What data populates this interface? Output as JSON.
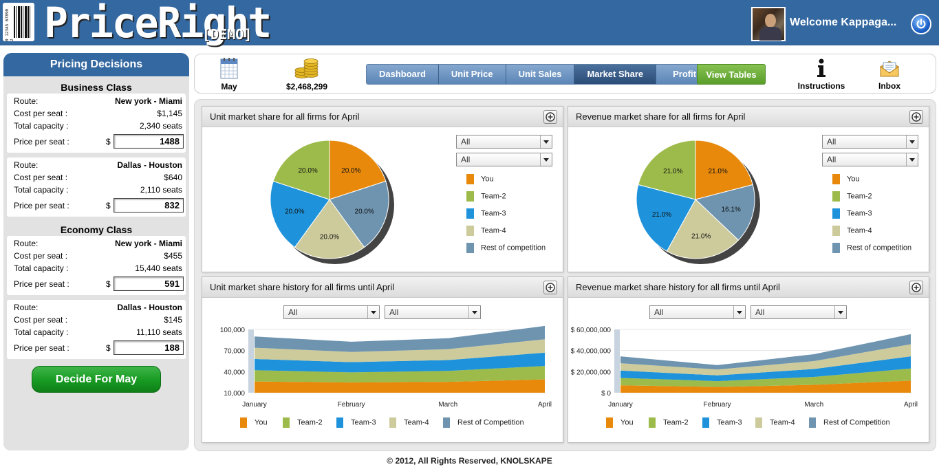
{
  "app": {
    "name": "PriceRight",
    "demo_tag": "[DEMO]",
    "barcode_digits": "0 12345 67890 2",
    "welcome": "Welcome Kappaga...",
    "footer": "© 2012, All Rights Reserved, KNOLSKAPE"
  },
  "pricing": {
    "title": "Pricing Decisions",
    "business_title": "Business Class",
    "economy_title": "Economy Class",
    "labels": {
      "route": "Route:",
      "cost": "Cost per seat :",
      "capacity": "Total capacity :",
      "price": "Price per seat :",
      "currency": "$"
    },
    "routes": [
      {
        "route": "New york - Miami",
        "cost": "$1,145",
        "capacity": "2,340 seats",
        "price": "1488"
      },
      {
        "route": "Dallas - Houston",
        "cost": "$640",
        "capacity": "2,110 seats",
        "price": "832"
      },
      {
        "route": "New york - Miami",
        "cost": "$455",
        "capacity": "15,440 seats",
        "price": "591"
      },
      {
        "route": "Dallas - Houston",
        "cost": "$145",
        "capacity": "11,110 seats",
        "price": "188"
      }
    ],
    "decide_button": "Decide For May"
  },
  "toolbar": {
    "month": "May",
    "cash": "$2,468,299",
    "tabs": [
      "Dashboard",
      "Unit Price",
      "Unit Sales",
      "Market Share",
      "Profit"
    ],
    "active_tab": "Market Share",
    "view_tables": "View Tables",
    "instructions": "Instructions",
    "inbox": "Inbox"
  },
  "colors": {
    "you": "#e8890c",
    "team2": "#9dbb4b",
    "team3": "#1e93db",
    "team4": "#cdcb9c",
    "rest": "#6e94b0",
    "header_blue": "#3468a0"
  },
  "filters": {
    "all": "All"
  },
  "panels": {
    "unit_pie_title": "Unit market share for all firms for April",
    "revenue_pie_title": "Revenue market share for all firms for April",
    "unit_hist_title": "Unit market share history for all firms until April",
    "revenue_hist_title": "Revenue market share history for all firms until April"
  },
  "pie_legend": [
    "You",
    "Team-2",
    "Team-3",
    "Team-4",
    "Rest of competition"
  ],
  "hist_legend": [
    "You",
    "Team-2",
    "Team-3",
    "Team-4",
    "Rest of Competition"
  ],
  "chart_data": [
    {
      "type": "pie",
      "title": "Unit market share for all firms for April",
      "categories": [
        "You",
        "Team-2",
        "Team-3",
        "Team-4",
        "Rest of competition"
      ],
      "values": [
        20.0,
        20.0,
        20.0,
        20.0,
        20.0
      ],
      "labels": [
        "20.0%",
        "20.0%",
        "20.0%",
        "20.0%",
        "20.0%"
      ]
    },
    {
      "type": "pie",
      "title": "Revenue market share for all firms for April",
      "categories": [
        "You",
        "Team-2",
        "Team-3",
        "Team-4",
        "Rest of competition"
      ],
      "values": [
        21.0,
        21.0,
        21.0,
        21.0,
        16.1
      ],
      "labels": [
        "21.0%",
        "21.0%",
        "21.0%",
        "21.0%",
        "16.1%"
      ]
    },
    {
      "type": "area",
      "title": "Unit market share history for all firms until April",
      "categories": [
        "January",
        "February",
        "March",
        "April"
      ],
      "yticks": [
        "10,000",
        "40,000",
        "70,000",
        "100,000"
      ],
      "ylim": [
        10000,
        100000
      ],
      "series": [
        {
          "name": "You",
          "values": [
            16000,
            14500,
            15500,
            19000
          ]
        },
        {
          "name": "Team-2",
          "values": [
            16000,
            14500,
            15500,
            19000
          ]
        },
        {
          "name": "Team-3",
          "values": [
            16000,
            14500,
            15500,
            19000
          ]
        },
        {
          "name": "Team-4",
          "values": [
            16000,
            14500,
            15500,
            19000
          ]
        },
        {
          "name": "Rest of Competition",
          "values": [
            16000,
            14500,
            15500,
            19000
          ]
        }
      ]
    },
    {
      "type": "area",
      "title": "Revenue market share history for all firms until April",
      "categories": [
        "January",
        "February",
        "March",
        "April"
      ],
      "yticks": [
        "$ 0",
        "$ 20,000,000",
        "$ 40,000,000",
        "$ 60,000,000"
      ],
      "ylim": [
        0,
        60000000
      ],
      "series": [
        {
          "name": "You",
          "values": [
            7000000,
            5500000,
            7500000,
            11500000
          ]
        },
        {
          "name": "Team-2",
          "values": [
            7000000,
            5500000,
            7500000,
            11500000
          ]
        },
        {
          "name": "Team-3",
          "values": [
            7000000,
            5500000,
            7500000,
            11500000
          ]
        },
        {
          "name": "Team-4",
          "values": [
            7000000,
            5500000,
            7500000,
            11500000
          ]
        },
        {
          "name": "Rest of Competition",
          "values": [
            6500000,
            4200000,
            6500000,
            9500000
          ]
        }
      ]
    }
  ]
}
